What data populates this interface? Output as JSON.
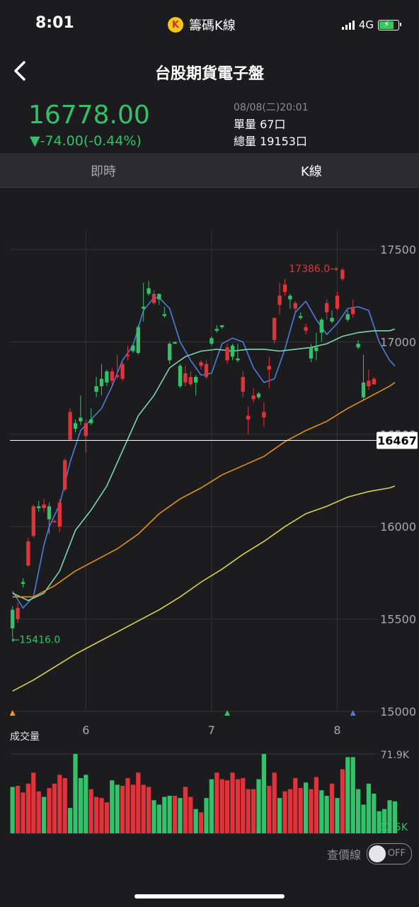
{
  "status_bar": {
    "time": "8:01",
    "app_name": "籌碼K線",
    "app_icon": "K",
    "network": "4G"
  },
  "header": {
    "title": "台股期貨電子盤",
    "back_icon": "chevron-left-icon"
  },
  "quote": {
    "price": "16778.00",
    "change": "▼-74.00(-0.44%)",
    "datetime": "08/08(二)20:01",
    "single_volume": "單量 67口",
    "total_volume": "總量 19153口",
    "color_down": "#33c26a",
    "color_up": "#e3333a"
  },
  "tabs": [
    {
      "label": "即時",
      "active": false
    },
    {
      "label": "K線",
      "active": true
    }
  ],
  "price_chart": {
    "y_ticks": [
      "17500",
      "17000",
      "16500",
      "16000",
      "15500",
      "15000"
    ],
    "x_ticks": [
      "6",
      "7",
      "8"
    ],
    "current_line_label": "16467",
    "high_label": "17386.0→",
    "low_label": "←15416.0",
    "volume_title": "成交量",
    "volume_max_label": "71.9K",
    "volume_min_label": "11.5K"
  },
  "toggle": {
    "label": "查價線",
    "state": "OFF"
  },
  "chart_data": {
    "type": "candlestick",
    "ylim": [
      15000,
      17600
    ],
    "current_line": 16467,
    "high": 17386.0,
    "low": 15416.0,
    "x_ticks": [
      {
        "label": "6",
        "index": 14
      },
      {
        "label": "7",
        "index": 38
      },
      {
        "label": "8",
        "index": 62
      }
    ],
    "candles": [
      [
        15550,
        15450,
        15570,
        15400
      ],
      [
        15500,
        15560,
        15590,
        15480
      ],
      [
        15700,
        15690,
        15720,
        15670
      ],
      [
        15790,
        15920,
        15940,
        15780
      ],
      [
        15950,
        16110,
        16120,
        15940
      ],
      [
        16110,
        16100,
        16140,
        16080
      ],
      [
        16100,
        16120,
        16150,
        16080
      ],
      [
        16110,
        16040,
        16130,
        15960
      ],
      [
        16030,
        16030,
        16040,
        16030
      ],
      [
        16000,
        16130,
        16150,
        15970
      ],
      [
        16200,
        16360,
        16370,
        16190
      ],
      [
        16470,
        16620,
        16640,
        16460
      ],
      [
        16560,
        16530,
        16580,
        16510
      ],
      [
        16590,
        16570,
        16710,
        16550
      ],
      [
        16490,
        16560,
        16580,
        16400
      ],
      [
        16580,
        16560,
        16640,
        16550
      ],
      [
        16760,
        16730,
        16810,
        16700
      ],
      [
        16800,
        16760,
        16880,
        16710
      ],
      [
        16840,
        16780,
        16850,
        16760
      ],
      [
        16790,
        16840,
        16860,
        16770
      ],
      [
        16810,
        16820,
        16930,
        16800
      ],
      [
        16800,
        16880,
        16890,
        16790
      ],
      [
        16930,
        16930,
        16980,
        16900
      ],
      [
        16980,
        16950,
        16990,
        16940
      ],
      [
        17080,
        16940,
        17090,
        16930
      ],
      [
        17190,
        17180,
        17320,
        17110
      ],
      [
        17290,
        17260,
        17330,
        17250
      ],
      [
        17210,
        17260,
        17280,
        17200
      ],
      [
        17260,
        17230,
        17260,
        17200
      ],
      [
        17150,
        17140,
        17190,
        17130
      ],
      [
        16990,
        16900,
        17000,
        16880
      ],
      [
        17000,
        16990,
        17000,
        16990
      ],
      [
        16870,
        16760,
        16880,
        16750
      ],
      [
        16780,
        16830,
        16870,
        16760
      ],
      [
        16770,
        16810,
        16840,
        16760
      ],
      [
        16810,
        16780,
        16820,
        16710
      ],
      [
        16870,
        16890,
        16900,
        16850
      ],
      [
        16810,
        16880,
        16900,
        16800
      ],
      [
        17020,
        16990,
        17030,
        16980
      ],
      [
        17070,
        17060,
        17090,
        17050
      ],
      [
        17090,
        17080,
        17090,
        17070
      ],
      [
        16900,
        16970,
        16990,
        16880
      ],
      [
        16980,
        16920,
        16990,
        16900
      ],
      [
        16910,
        16900,
        16990,
        16890
      ],
      [
        16730,
        16810,
        16840,
        16700
      ],
      [
        16580,
        16600,
        16650,
        16500
      ],
      [
        16690,
        16710,
        16750,
        16670
      ],
      [
        16720,
        16700,
        16730,
        16690
      ],
      [
        16590,
        16620,
        16670,
        16540
      ],
      [
        16850,
        16870,
        16920,
        16750
      ],
      [
        17010,
        17130,
        17130,
        16990
      ],
      [
        17200,
        17250,
        17320,
        17150
      ],
      [
        17270,
        17310,
        17340,
        17250
      ],
      [
        17250,
        17230,
        17260,
        17180
      ],
      [
        17180,
        17210,
        17220,
        17160
      ],
      [
        17140,
        17130,
        17160,
        17120
      ],
      [
        17060,
        17080,
        17100,
        17040
      ],
      [
        16970,
        16910,
        16990,
        16890
      ],
      [
        16970,
        16950,
        17050,
        16900
      ],
      [
        17120,
        17050,
        17130,
        17000
      ],
      [
        17160,
        17210,
        17230,
        17120
      ],
      [
        17130,
        17110,
        17170,
        17100
      ],
      [
        17180,
        17250,
        17270,
        17170
      ],
      [
        17340,
        17390,
        17400,
        17330
      ],
      [
        17150,
        17120,
        17170,
        17110
      ],
      [
        17150,
        17180,
        17230,
        17130
      ],
      [
        16990,
        16970,
        17010,
        16960
      ],
      [
        16780,
        16700,
        16930,
        16680
      ],
      [
        16760,
        16790,
        16850,
        16740
      ],
      [
        16770,
        16800,
        16810,
        16790
      ]
    ],
    "ma_lines": [
      {
        "color": "#4a7de0",
        "points": [
          [
            0,
            15650
          ],
          [
            2,
            15560
          ],
          [
            4,
            15620
          ],
          [
            6,
            15900
          ],
          [
            7,
            16000
          ],
          [
            9,
            16120
          ],
          [
            11,
            16350
          ],
          [
            13,
            16520
          ],
          [
            15,
            16580
          ],
          [
            17,
            16640
          ],
          [
            19,
            16760
          ],
          [
            21,
            16900
          ],
          [
            23,
            16980
          ],
          [
            25,
            17170
          ],
          [
            27,
            17240
          ],
          [
            28,
            17240
          ],
          [
            30,
            17180
          ],
          [
            32,
            17000
          ],
          [
            34,
            16900
          ],
          [
            36,
            16820
          ],
          [
            38,
            16830
          ],
          [
            40,
            16990
          ],
          [
            42,
            17020
          ],
          [
            44,
            17000
          ],
          [
            46,
            16860
          ],
          [
            48,
            16780
          ],
          [
            50,
            16800
          ],
          [
            52,
            16960
          ],
          [
            54,
            17160
          ],
          [
            56,
            17220
          ],
          [
            58,
            17120
          ],
          [
            60,
            17040
          ],
          [
            62,
            17100
          ],
          [
            64,
            17180
          ],
          [
            66,
            17190
          ],
          [
            68,
            17170
          ],
          [
            70,
            17000
          ],
          [
            72,
            16900
          ],
          [
            73,
            16870
          ]
        ]
      },
      {
        "color": "#7ed6b0",
        "points": [
          [
            0,
            15640
          ],
          [
            3,
            15600
          ],
          [
            6,
            15640
          ],
          [
            9,
            15760
          ],
          [
            12,
            15980
          ],
          [
            15,
            16090
          ],
          [
            18,
            16220
          ],
          [
            21,
            16410
          ],
          [
            24,
            16600
          ],
          [
            27,
            16710
          ],
          [
            30,
            16860
          ],
          [
            33,
            16920
          ],
          [
            36,
            16950
          ],
          [
            39,
            16960
          ],
          [
            42,
            16950
          ],
          [
            45,
            16960
          ],
          [
            48,
            16960
          ],
          [
            51,
            16950
          ],
          [
            54,
            16960
          ],
          [
            57,
            16970
          ],
          [
            60,
            16990
          ],
          [
            63,
            17030
          ],
          [
            66,
            17050
          ],
          [
            69,
            17060
          ],
          [
            72,
            17060
          ],
          [
            73,
            17070
          ]
        ]
      },
      {
        "color": "#e39020",
        "points": [
          [
            0,
            15620
          ],
          [
            4,
            15620
          ],
          [
            8,
            15680
          ],
          [
            12,
            15760
          ],
          [
            16,
            15820
          ],
          [
            20,
            15880
          ],
          [
            24,
            15960
          ],
          [
            28,
            16070
          ],
          [
            32,
            16150
          ],
          [
            36,
            16210
          ],
          [
            40,
            16280
          ],
          [
            44,
            16330
          ],
          [
            48,
            16380
          ],
          [
            52,
            16460
          ],
          [
            56,
            16520
          ],
          [
            60,
            16570
          ],
          [
            64,
            16640
          ],
          [
            68,
            16700
          ],
          [
            72,
            16760
          ],
          [
            73,
            16780
          ]
        ]
      },
      {
        "color": "#d8d050",
        "points": [
          [
            0,
            15110
          ],
          [
            4,
            15170
          ],
          [
            8,
            15240
          ],
          [
            12,
            15310
          ],
          [
            16,
            15370
          ],
          [
            20,
            15430
          ],
          [
            24,
            15490
          ],
          [
            28,
            15550
          ],
          [
            32,
            15620
          ],
          [
            36,
            15700
          ],
          [
            40,
            15770
          ],
          [
            44,
            15850
          ],
          [
            48,
            15920
          ],
          [
            52,
            16000
          ],
          [
            56,
            16070
          ],
          [
            60,
            16110
          ],
          [
            64,
            16160
          ],
          [
            68,
            16190
          ],
          [
            72,
            16210
          ],
          [
            73,
            16220
          ]
        ]
      }
    ],
    "volume": {
      "max": 71900,
      "min": 11500,
      "bars": [
        [
          42000,
          "green"
        ],
        [
          43000,
          "red"
        ],
        [
          37000,
          "red"
        ],
        [
          45000,
          "red"
        ],
        [
          55000,
          "red"
        ],
        [
          38000,
          "red"
        ],
        [
          33000,
          "green"
        ],
        [
          41000,
          "red"
        ],
        [
          45000,
          "red"
        ],
        [
          53000,
          "red"
        ],
        [
          50000,
          "red"
        ],
        [
          23000,
          "green"
        ],
        [
          72000,
          "green"
        ],
        [
          50000,
          "green"
        ],
        [
          53000,
          "green"
        ],
        [
          40000,
          "red"
        ],
        [
          33000,
          "red"
        ],
        [
          32000,
          "red"
        ],
        [
          28000,
          "red"
        ],
        [
          48000,
          "green"
        ],
        [
          44000,
          "green"
        ],
        [
          43000,
          "red"
        ],
        [
          50000,
          "red"
        ],
        [
          44000,
          "red"
        ],
        [
          55000,
          "red"
        ],
        [
          44000,
          "red"
        ],
        [
          42000,
          "red"
        ],
        [
          30000,
          "green"
        ],
        [
          26000,
          "green"
        ],
        [
          33000,
          "green"
        ],
        [
          34000,
          "green"
        ],
        [
          34000,
          "red"
        ],
        [
          32000,
          "green"
        ],
        [
          42000,
          "red"
        ],
        [
          33000,
          "red"
        ],
        [
          22000,
          "green"
        ],
        [
          19000,
          "red"
        ],
        [
          32000,
          "green"
        ],
        [
          49000,
          "green"
        ],
        [
          55000,
          "red"
        ],
        [
          49000,
          "red"
        ],
        [
          48000,
          "red"
        ],
        [
          55000,
          "red"
        ],
        [
          49000,
          "red"
        ],
        [
          50000,
          "red"
        ],
        [
          40000,
          "red"
        ],
        [
          40000,
          "red"
        ],
        [
          49000,
          "green"
        ],
        [
          72000,
          "green"
        ],
        [
          43000,
          "red"
        ],
        [
          55000,
          "red"
        ],
        [
          32000,
          "green"
        ],
        [
          38000,
          "red"
        ],
        [
          40000,
          "red"
        ],
        [
          50000,
          "red"
        ],
        [
          41000,
          "red"
        ],
        [
          46000,
          "green"
        ],
        [
          40000,
          "red"
        ],
        [
          51000,
          "red"
        ],
        [
          39000,
          "green"
        ],
        [
          34000,
          "green"
        ],
        [
          45000,
          "red"
        ],
        [
          32000,
          "green"
        ],
        [
          58000,
          "red"
        ],
        [
          69000,
          "green"
        ],
        [
          69000,
          "green"
        ],
        [
          40000,
          "green"
        ],
        [
          26000,
          "green"
        ],
        [
          45000,
          "green"
        ],
        [
          36000,
          "green"
        ],
        [
          20000,
          "green"
        ],
        [
          22000,
          "green"
        ],
        [
          30000,
          "green"
        ],
        [
          29000,
          "green"
        ]
      ]
    }
  }
}
